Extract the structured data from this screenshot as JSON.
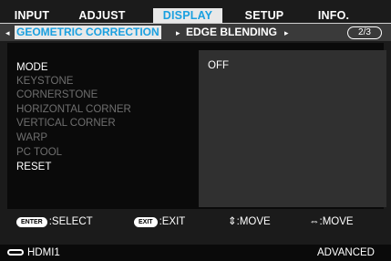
{
  "tabs": [
    "INPUT",
    "ADJUST",
    "DISPLAY",
    "SETUP",
    "INFO."
  ],
  "active_tab": "DISPLAY",
  "submenu": {
    "items": [
      "GEOMETRIC CORRECTION",
      "EDGE BLENDING"
    ],
    "active": "GEOMETRIC CORRECTION",
    "left_arrow": "◂",
    "right_arrow": "▸",
    "page": "2/3"
  },
  "menu": [
    {
      "label": "MODE",
      "enabled": true
    },
    {
      "label": "KEYSTONE",
      "enabled": false
    },
    {
      "label": "CORNERSTONE",
      "enabled": false
    },
    {
      "label": "HORIZONTAL CORNER",
      "enabled": false
    },
    {
      "label": "VERTICAL CORNER",
      "enabled": false
    },
    {
      "label": "WARP",
      "enabled": false
    },
    {
      "label": "PC TOOL",
      "enabled": false
    },
    {
      "label": "RESET",
      "enabled": true
    }
  ],
  "value": "OFF",
  "footer": {
    "enter_key": "ENTER",
    "enter_label": ":SELECT",
    "exit_key": "EXIT",
    "exit_label": ":EXIT",
    "move_vertical": "⇕:MOVE",
    "move_horizontal": "⇔:MOVE"
  },
  "status": {
    "source": "HDMI1",
    "mode": "ADVANCED",
    "source_icon": "hdmi-connector-icon"
  },
  "colors": {
    "accent": "#1aa0e0",
    "highlight_bg": "#e8e8e8",
    "background": "#1b1b1b",
    "disabled_text": "#6e6e6e"
  }
}
